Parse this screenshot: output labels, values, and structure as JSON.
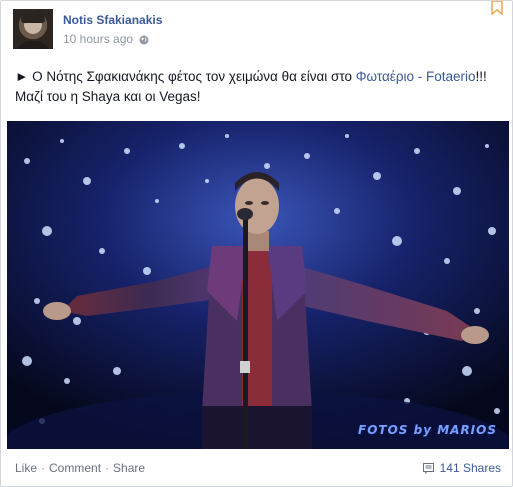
{
  "post": {
    "author": "Notis Sfakianakis",
    "time": "10 hours ago",
    "privacy_icon": "globe-icon",
    "text_prefix": "► Ο Νότης Σφακιανάκης φέτος τον χειμώνα θα είναι στο ",
    "link_text": "Φωταέριο - Fotaerio",
    "text_suffix": "!!! Μαζί του η Shaya και οι Vegas!",
    "photo_watermark": "FOTOS by MARIOS"
  },
  "footer": {
    "like_label": "Like",
    "comment_label": "Comment",
    "share_label": "Share",
    "separator": "·",
    "shares_count": "141 Shares"
  },
  "colors": {
    "link": "#3b5998",
    "muted": "#9197a3",
    "photo_bg": "#0a0f2e"
  }
}
